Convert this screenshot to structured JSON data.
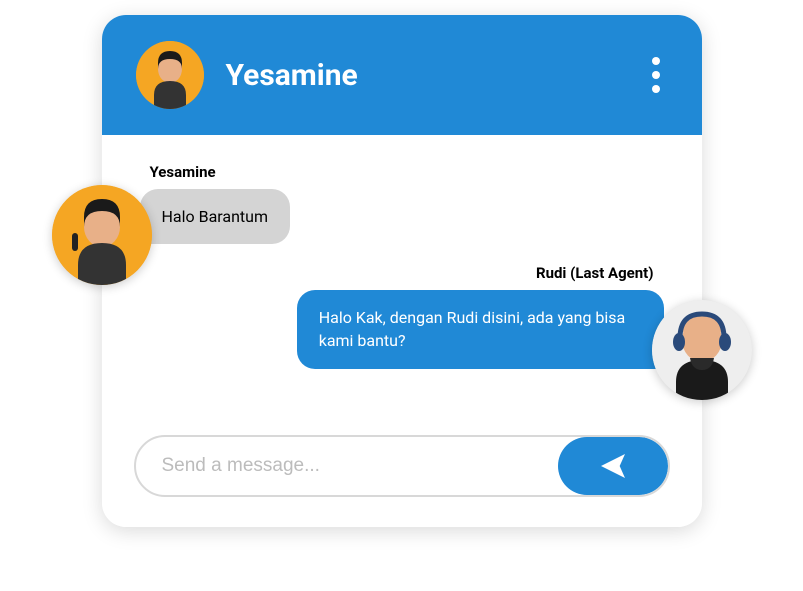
{
  "header": {
    "contact_name": "Yesamine"
  },
  "messages": [
    {
      "sender": "Yesamine",
      "text": "Halo Barantum",
      "side": "left"
    },
    {
      "sender": "Rudi (Last Agent)",
      "text": "Halo Kak, dengan Rudi disini, ada yang bisa kami bantu?",
      "side": "right"
    }
  ],
  "composer": {
    "placeholder": "Send a message..."
  },
  "colors": {
    "primary": "#2089d6",
    "bubble_other": "#d4d4d4",
    "avatar_bg": "#f5a623"
  }
}
